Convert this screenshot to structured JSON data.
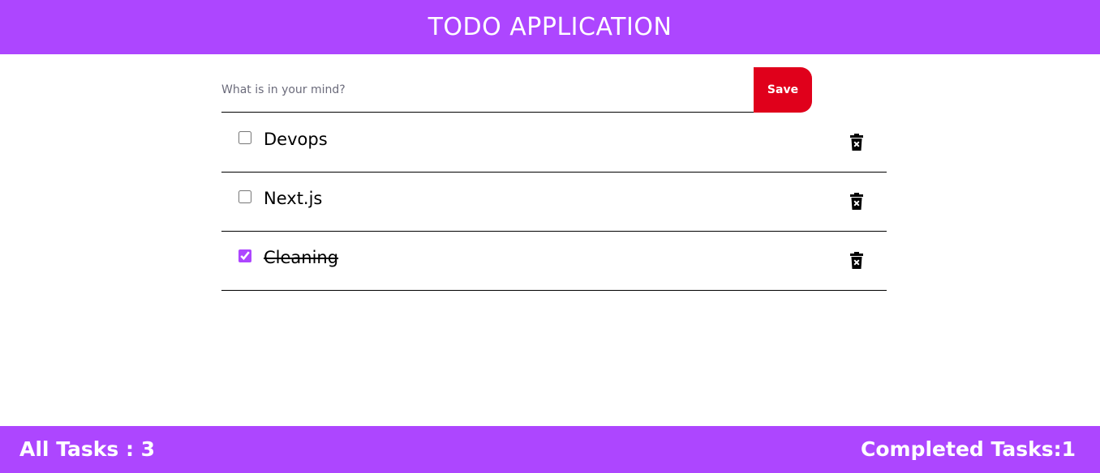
{
  "header": {
    "title": "TODO APPLICATION"
  },
  "form": {
    "input_value": "",
    "input_placeholder": "What is in your mind?",
    "save_label": "Save"
  },
  "tasks": [
    {
      "label": "Devops",
      "completed": false
    },
    {
      "label": "Next.js",
      "completed": false
    },
    {
      "label": "Cleaning",
      "completed": true
    }
  ],
  "footer": {
    "all_tasks_text": "All Tasks : 3",
    "completed_tasks_text": "Completed Tasks:1"
  },
  "icons": {
    "delete": "trash-x-icon"
  },
  "colors": {
    "accent": "#ad46ff",
    "save_button": "#e0001b",
    "text": "#000000"
  }
}
